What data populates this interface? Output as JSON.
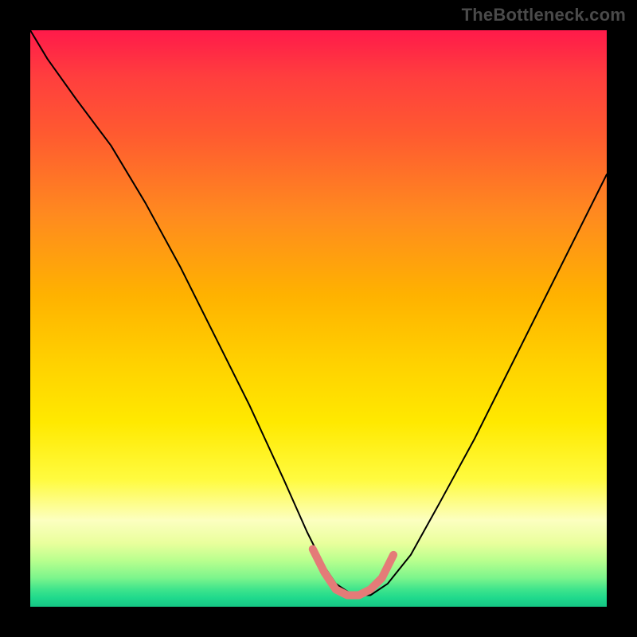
{
  "watermark": "TheBottleneck.com",
  "chart_data": {
    "type": "line",
    "title": "",
    "xlabel": "",
    "ylabel": "",
    "xlim": [
      0,
      100
    ],
    "ylim": [
      0,
      100
    ],
    "grid": false,
    "legend": false,
    "background_gradient": {
      "direction": "vertical",
      "stops": [
        {
          "pos": 0.0,
          "color": "#ff1a4a"
        },
        {
          "pos": 0.2,
          "color": "#ff5a30"
        },
        {
          "pos": 0.45,
          "color": "#ffb200"
        },
        {
          "pos": 0.65,
          "color": "#ffe900"
        },
        {
          "pos": 0.85,
          "color": "#fcffc0"
        },
        {
          "pos": 1.0,
          "color": "#15c584"
        }
      ]
    },
    "series": [
      {
        "name": "bottleneck-curve",
        "color": "#000000",
        "stroke_width": 2,
        "x": [
          0,
          3,
          8,
          14,
          20,
          26,
          32,
          38,
          44,
          48,
          51,
          53,
          56,
          59,
          62,
          66,
          71,
          77,
          83,
          89,
          95,
          100
        ],
        "values": [
          100,
          95,
          88,
          80,
          70,
          59,
          47,
          35,
          22,
          13,
          7,
          4,
          2,
          2,
          4,
          9,
          18,
          29,
          41,
          53,
          65,
          75
        ]
      },
      {
        "name": "optimal-zone-marker",
        "color": "#e47b78",
        "stroke_width": 10,
        "x": [
          49,
          51,
          53,
          55,
          57,
          59,
          61,
          63
        ],
        "values": [
          10,
          6,
          3,
          2,
          2,
          3,
          5,
          9
        ]
      }
    ]
  }
}
